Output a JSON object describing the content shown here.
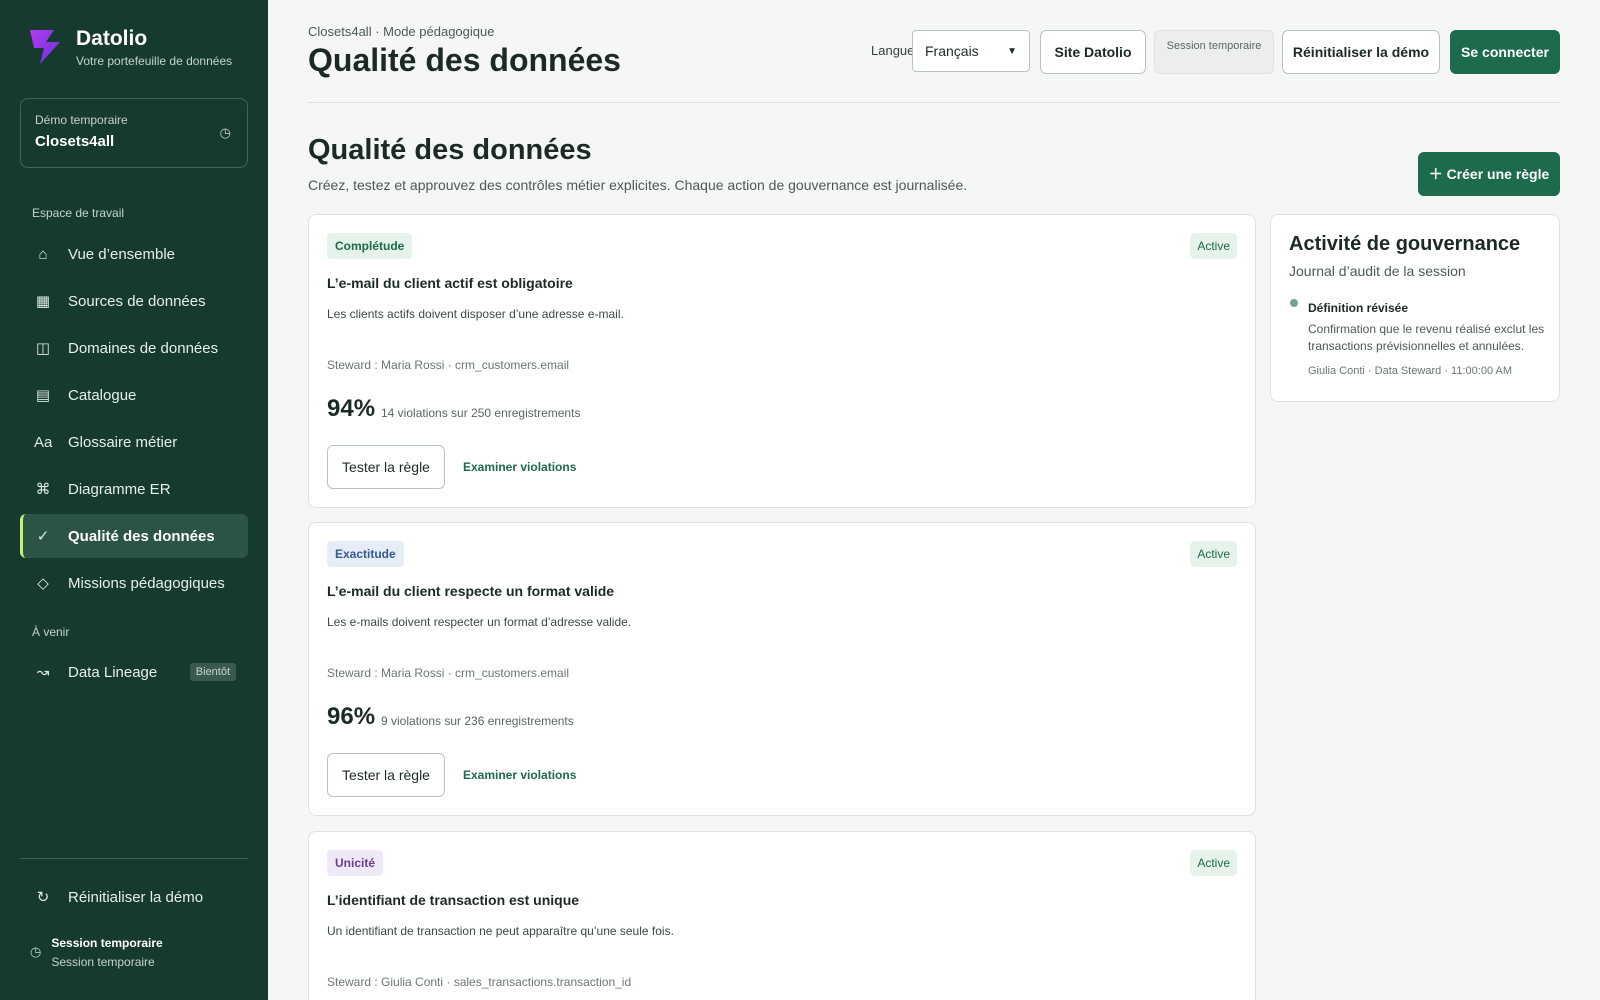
{
  "app": {
    "name": "Datolio",
    "tagline": "Votre portefeuille de données"
  },
  "demo": {
    "label": "Démo temporaire",
    "value": "Closets4all"
  },
  "sidebar": {
    "workspace_label": "Espace de travail",
    "items": [
      {
        "label": "Vue d’ensemble",
        "icon": "home-icon"
      },
      {
        "label": "Sources de données",
        "icon": "grid-icon"
      },
      {
        "label": "Domaines de données",
        "icon": "columns-icon"
      },
      {
        "label": "Catalogue",
        "icon": "list-icon"
      },
      {
        "label": "Glossaire métier",
        "icon": "text-icon"
      },
      {
        "label": "Diagramme ER",
        "icon": "command-icon"
      },
      {
        "label": "Qualité des données",
        "icon": "check-icon",
        "active": true
      },
      {
        "label": "Missions pédagogiques",
        "icon": "diamond-icon"
      }
    ],
    "upcoming_label": "À venir",
    "upcoming": {
      "label": "Data Lineage",
      "badge": "Bientôt"
    },
    "reset_label": "Réinitialiser la démo",
    "session": {
      "title": "Session temporaire",
      "sub": "Session temporaire"
    }
  },
  "header": {
    "crumb": "Closets4all · Mode pédagogique",
    "title": "Qualité des données",
    "lang_label": "Langue",
    "lang_value": "Français",
    "site_button": "Site Datolio",
    "session_pill": "Session temporaire",
    "reset_button": "Réinitialiser la démo",
    "login_button": "Se connecter"
  },
  "page": {
    "title": "Qualité des données",
    "description": "Créez, testez et approuvez des contrôles métier explicites. Chaque action de gouvernance est journalisée.",
    "create_button": "＋ Créer une règle"
  },
  "rules": [
    {
      "tag": "Complétude",
      "status": "Active",
      "title": "L’e-mail du client actif est obligatoire",
      "description": "Les clients actifs doivent disposer d’une adresse e-mail.",
      "steward": "Steward : Maria Rossi · crm_customers.email",
      "score": "94%",
      "violations": "14 violations sur 250 enregistrements",
      "test_label": "Tester la règle",
      "examine_label": "Examiner violations"
    },
    {
      "tag": "Exactitude",
      "status": "Active",
      "title": "L’e-mail du client respecte un format valide",
      "description": "Les e-mails doivent respecter un format d’adresse valide.",
      "steward": "Steward : Maria Rossi · crm_customers.email",
      "score": "96%",
      "violations": "9 violations sur 236 enregistrements",
      "test_label": "Tester la règle",
      "examine_label": "Examiner violations"
    },
    {
      "tag": "Unicité",
      "status": "Active",
      "title": "L’identifiant de transaction est unique",
      "description": "Un identifiant de transaction ne peut apparaître qu’une seule fois.",
      "steward": "Steward : Giulia Conti · sales_transactions.transaction_id"
    }
  ],
  "activity": {
    "title": "Activité de gouvernance",
    "subtitle": "Journal d’audit de la session",
    "entry": {
      "title": "Définition révisée",
      "body": "Confirmation que le revenu réalisé exclut les transactions prévisionnelles et annulées.",
      "meta": "Giulia Conti · Data Steward · 11:00:00 AM"
    }
  }
}
